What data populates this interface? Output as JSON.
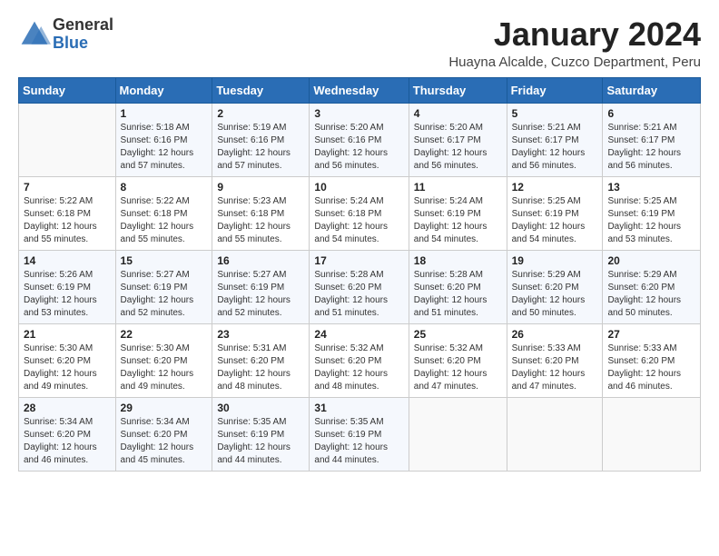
{
  "logo": {
    "general": "General",
    "blue": "Blue"
  },
  "title": "January 2024",
  "subtitle": "Huayna Alcalde, Cuzco Department, Peru",
  "days_of_week": [
    "Sunday",
    "Monday",
    "Tuesday",
    "Wednesday",
    "Thursday",
    "Friday",
    "Saturday"
  ],
  "weeks": [
    [
      {
        "day": "",
        "info": ""
      },
      {
        "day": "1",
        "info": "Sunrise: 5:18 AM\nSunset: 6:16 PM\nDaylight: 12 hours\nand 57 minutes."
      },
      {
        "day": "2",
        "info": "Sunrise: 5:19 AM\nSunset: 6:16 PM\nDaylight: 12 hours\nand 57 minutes."
      },
      {
        "day": "3",
        "info": "Sunrise: 5:20 AM\nSunset: 6:16 PM\nDaylight: 12 hours\nand 56 minutes."
      },
      {
        "day": "4",
        "info": "Sunrise: 5:20 AM\nSunset: 6:17 PM\nDaylight: 12 hours\nand 56 minutes."
      },
      {
        "day": "5",
        "info": "Sunrise: 5:21 AM\nSunset: 6:17 PM\nDaylight: 12 hours\nand 56 minutes."
      },
      {
        "day": "6",
        "info": "Sunrise: 5:21 AM\nSunset: 6:17 PM\nDaylight: 12 hours\nand 56 minutes."
      }
    ],
    [
      {
        "day": "7",
        "info": "Sunrise: 5:22 AM\nSunset: 6:18 PM\nDaylight: 12 hours\nand 55 minutes."
      },
      {
        "day": "8",
        "info": "Sunrise: 5:22 AM\nSunset: 6:18 PM\nDaylight: 12 hours\nand 55 minutes."
      },
      {
        "day": "9",
        "info": "Sunrise: 5:23 AM\nSunset: 6:18 PM\nDaylight: 12 hours\nand 55 minutes."
      },
      {
        "day": "10",
        "info": "Sunrise: 5:24 AM\nSunset: 6:18 PM\nDaylight: 12 hours\nand 54 minutes."
      },
      {
        "day": "11",
        "info": "Sunrise: 5:24 AM\nSunset: 6:19 PM\nDaylight: 12 hours\nand 54 minutes."
      },
      {
        "day": "12",
        "info": "Sunrise: 5:25 AM\nSunset: 6:19 PM\nDaylight: 12 hours\nand 54 minutes."
      },
      {
        "day": "13",
        "info": "Sunrise: 5:25 AM\nSunset: 6:19 PM\nDaylight: 12 hours\nand 53 minutes."
      }
    ],
    [
      {
        "day": "14",
        "info": "Sunrise: 5:26 AM\nSunset: 6:19 PM\nDaylight: 12 hours\nand 53 minutes."
      },
      {
        "day": "15",
        "info": "Sunrise: 5:27 AM\nSunset: 6:19 PM\nDaylight: 12 hours\nand 52 minutes."
      },
      {
        "day": "16",
        "info": "Sunrise: 5:27 AM\nSunset: 6:19 PM\nDaylight: 12 hours\nand 52 minutes."
      },
      {
        "day": "17",
        "info": "Sunrise: 5:28 AM\nSunset: 6:20 PM\nDaylight: 12 hours\nand 51 minutes."
      },
      {
        "day": "18",
        "info": "Sunrise: 5:28 AM\nSunset: 6:20 PM\nDaylight: 12 hours\nand 51 minutes."
      },
      {
        "day": "19",
        "info": "Sunrise: 5:29 AM\nSunset: 6:20 PM\nDaylight: 12 hours\nand 50 minutes."
      },
      {
        "day": "20",
        "info": "Sunrise: 5:29 AM\nSunset: 6:20 PM\nDaylight: 12 hours\nand 50 minutes."
      }
    ],
    [
      {
        "day": "21",
        "info": "Sunrise: 5:30 AM\nSunset: 6:20 PM\nDaylight: 12 hours\nand 49 minutes."
      },
      {
        "day": "22",
        "info": "Sunrise: 5:30 AM\nSunset: 6:20 PM\nDaylight: 12 hours\nand 49 minutes."
      },
      {
        "day": "23",
        "info": "Sunrise: 5:31 AM\nSunset: 6:20 PM\nDaylight: 12 hours\nand 48 minutes."
      },
      {
        "day": "24",
        "info": "Sunrise: 5:32 AM\nSunset: 6:20 PM\nDaylight: 12 hours\nand 48 minutes."
      },
      {
        "day": "25",
        "info": "Sunrise: 5:32 AM\nSunset: 6:20 PM\nDaylight: 12 hours\nand 47 minutes."
      },
      {
        "day": "26",
        "info": "Sunrise: 5:33 AM\nSunset: 6:20 PM\nDaylight: 12 hours\nand 47 minutes."
      },
      {
        "day": "27",
        "info": "Sunrise: 5:33 AM\nSunset: 6:20 PM\nDaylight: 12 hours\nand 46 minutes."
      }
    ],
    [
      {
        "day": "28",
        "info": "Sunrise: 5:34 AM\nSunset: 6:20 PM\nDaylight: 12 hours\nand 46 minutes."
      },
      {
        "day": "29",
        "info": "Sunrise: 5:34 AM\nSunset: 6:20 PM\nDaylight: 12 hours\nand 45 minutes."
      },
      {
        "day": "30",
        "info": "Sunrise: 5:35 AM\nSunset: 6:19 PM\nDaylight: 12 hours\nand 44 minutes."
      },
      {
        "day": "31",
        "info": "Sunrise: 5:35 AM\nSunset: 6:19 PM\nDaylight: 12 hours\nand 44 minutes."
      },
      {
        "day": "",
        "info": ""
      },
      {
        "day": "",
        "info": ""
      },
      {
        "day": "",
        "info": ""
      }
    ]
  ]
}
